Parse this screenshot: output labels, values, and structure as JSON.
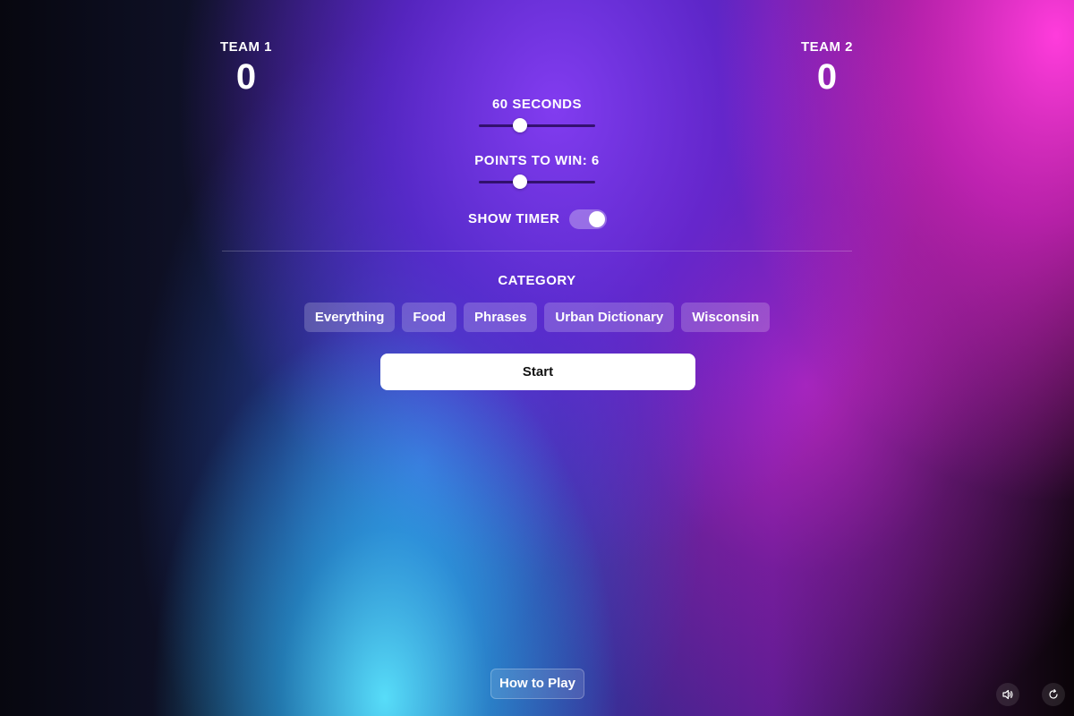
{
  "scoreboard": {
    "team1": {
      "label": "TEAM 1",
      "score": "0"
    },
    "team2": {
      "label": "TEAM 2",
      "score": "0"
    }
  },
  "settings": {
    "seconds": {
      "label": "60 SECONDS",
      "value": 60,
      "fraction": 0.35
    },
    "points_to_win": {
      "label": "POINTS TO WIN: 6",
      "value": 6,
      "fraction": 0.35
    },
    "show_timer": {
      "label": "SHOW TIMER",
      "enabled": true
    }
  },
  "category": {
    "title": "CATEGORY",
    "options": [
      "Everything",
      "Food",
      "Phrases",
      "Urban Dictionary",
      "Wisconsin"
    ]
  },
  "actions": {
    "start_label": "Start",
    "how_to_play_label": "How to Play"
  },
  "corner_icons": [
    "speaker-icon",
    "refresh-icon"
  ],
  "colors": {
    "magenta": "#ff3cdc",
    "violet": "#7a3cf0",
    "cyan": "#5ae6ff",
    "button_bg": "#ffffff"
  }
}
